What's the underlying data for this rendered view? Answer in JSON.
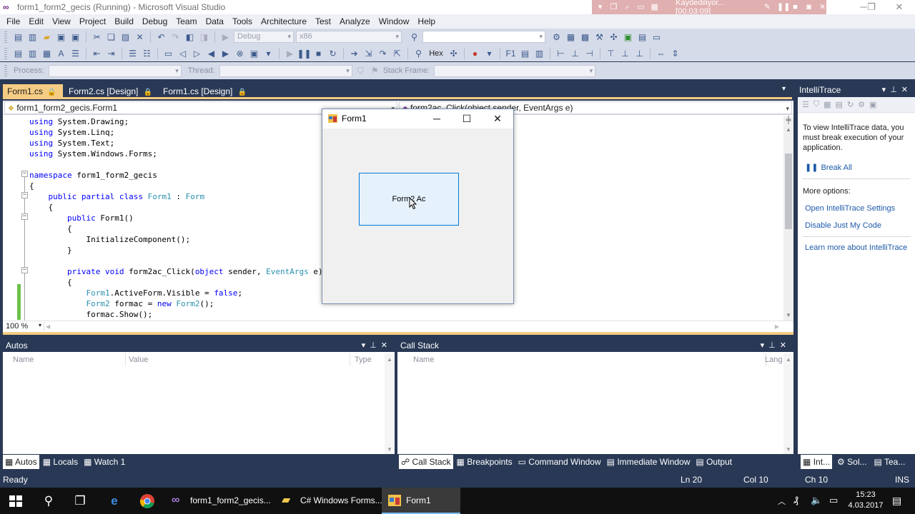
{
  "window": {
    "title": "form1_form2_gecis (Running) - Microsoft Visual Studio",
    "recorder_status": "Kaydediliyor... [00:03:09]"
  },
  "menu": [
    "File",
    "Edit",
    "View",
    "Project",
    "Build",
    "Debug",
    "Team",
    "Data",
    "Tools",
    "Architecture",
    "Test",
    "Analyze",
    "Window",
    "Help"
  ],
  "toolbar": {
    "config": "Debug",
    "platform": "x86",
    "hex_label": "Hex",
    "process_label": "Process:",
    "thread_label": "Thread:",
    "stack_frame_label": "Stack Frame:"
  },
  "doc_tabs": [
    {
      "label": "Form1.cs",
      "active": true
    },
    {
      "label": "Form2.cs [Design]",
      "active": false
    },
    {
      "label": "Form1.cs [Design]",
      "active": false
    }
  ],
  "editor": {
    "class_nav": "form1_form2_gecis.Form1",
    "member_nav": "form2ac_Click(object sender, EventArgs e)",
    "zoom": "100 %"
  },
  "code_lines": [
    "using System.Drawing;",
    "using System.Linq;",
    "using System.Text;",
    "using System.Windows.Forms;",
    "",
    "namespace form1_form2_gecis",
    "{",
    "    public partial class Form1 : Form",
    "    {",
    "        public Form1()",
    "        {",
    "            InitializeComponent();",
    "        }",
    "",
    "        private void form2ac_Click(object sender, EventArgs e)",
    "        {",
    "            Form1.ActiveForm.Visible = false;",
    "            Form2 formac = new Form2();",
    "            formac.Show();"
  ],
  "form1_window": {
    "title": "Form1",
    "button_label": "Form2 Ac"
  },
  "intellitrace": {
    "title": "IntelliTrace",
    "message": "To view IntelliTrace data, you must break execution of your application.",
    "break_all": "Break All",
    "more_options": "More options:",
    "links": [
      "Open IntelliTrace Settings",
      "Disable Just My Code"
    ],
    "learn_more": "Learn more about IntelliTrace",
    "tabs": [
      "Int...",
      "Sol...",
      "Tea..."
    ]
  },
  "autos": {
    "title": "Autos",
    "columns": [
      "Name",
      "Value",
      "Type"
    ],
    "tabs": [
      "Autos",
      "Locals",
      "Watch 1"
    ]
  },
  "call_stack": {
    "title": "Call Stack",
    "columns": [
      "Name",
      "Lang"
    ],
    "tabs": [
      "Call Stack",
      "Breakpoints",
      "Command Window",
      "Immediate Window",
      "Output"
    ]
  },
  "status": {
    "ready": "Ready",
    "ln": "Ln 20",
    "col": "Col 10",
    "ch": "Ch 10",
    "ins": "INS"
  },
  "taskbar": {
    "tasks": [
      "form1_form2_gecis...",
      "C# Windows Forms...",
      "Form1"
    ],
    "time": "15:23",
    "date": "4.03.2017"
  }
}
